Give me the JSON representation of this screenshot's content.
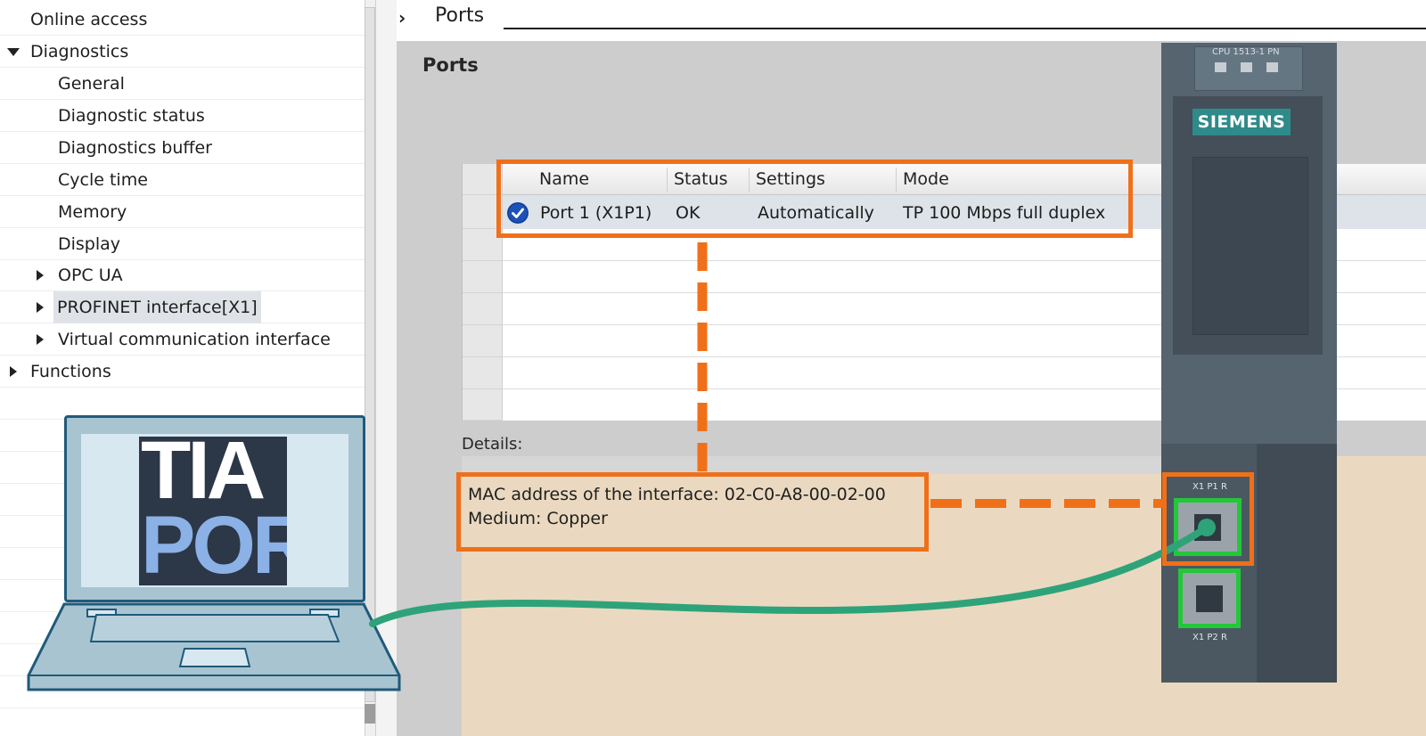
{
  "nav": {
    "items": [
      {
        "label": "Online access",
        "expander": "none"
      },
      {
        "label": "Diagnostics",
        "expander": "expanded"
      },
      {
        "label": "General",
        "expander": "none"
      },
      {
        "label": "Diagnostic status",
        "expander": "none"
      },
      {
        "label": "Diagnostics buffer",
        "expander": "none"
      },
      {
        "label": "Cycle time",
        "expander": "none"
      },
      {
        "label": "Memory",
        "expander": "none"
      },
      {
        "label": "Display",
        "expander": "none"
      },
      {
        "label": "OPC UA",
        "expander": "collapsed"
      },
      {
        "label": "PROFINET interface[X1]",
        "expander": "collapsed",
        "selected": true
      },
      {
        "label": "Virtual communication interface",
        "expander": "collapsed"
      },
      {
        "label": "Functions",
        "expander": "collapsed"
      }
    ]
  },
  "breadcrumb": {
    "chevron": "›",
    "label": "Ports"
  },
  "panel": {
    "title": "Ports"
  },
  "ports_table": {
    "columns": [
      "Name",
      "Status",
      "Settings",
      "Mode"
    ],
    "rows": [
      {
        "icon": "check-circle-icon",
        "name": "Port 1 (X1P1)",
        "status": "OK",
        "settings": "Automatically",
        "mode": "TP 100 Mbps full duplex"
      }
    ]
  },
  "details": {
    "label": "Details:",
    "mac_line": "MAC address of the interface:  02-C0-A8-00-02-00",
    "medium_line": "Medium:  Copper"
  },
  "plc": {
    "model": "CPU 1513-1 PN",
    "brand": "SIEMENS",
    "port1_label": "X1 P1 R",
    "port2_label": "X1 P2 R"
  },
  "laptop": {
    "logo_line1": "TIA",
    "logo_line2": "POR"
  },
  "colors": {
    "highlight": "#f0701a",
    "port_ok": "#22c839",
    "cable": "#2ea37a",
    "brand": "#2f8a8a"
  }
}
